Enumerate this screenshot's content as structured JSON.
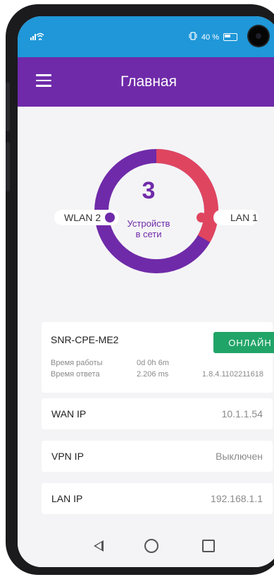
{
  "status_bar": {
    "signal_icon": "signal-wifi-icon",
    "battery_text": "40 %",
    "vibrate_icon": "vibrate-icon"
  },
  "appbar": {
    "title": "Главная"
  },
  "summary": {
    "device_count": "3",
    "device_count_label_line1": "Устройств",
    "device_count_label_line2": "в сети",
    "left_label": "WLAN 2",
    "right_label": "LAN 1",
    "ring_colors": {
      "purple": "#6f2aa9",
      "red": "#e0455f"
    }
  },
  "device": {
    "name": "SNR-CPE-ME2",
    "status": "ОНЛАЙН",
    "uptime_label": "Время работы",
    "uptime_value": "0d 0h 6m",
    "response_label": "Время ответа",
    "response_value": "2.206 ms",
    "firmware": "1.8.4.1102211618"
  },
  "rows": [
    {
      "label": "WAN IP",
      "value": "10.1.1.54"
    },
    {
      "label": "VPN IP",
      "value": "Выключен"
    },
    {
      "label": "LAN IP",
      "value": "192.168.1.1"
    }
  ],
  "colors": {
    "statusbar": "#1f97d8",
    "appbar": "#6f2aa9",
    "online": "#21a468"
  }
}
